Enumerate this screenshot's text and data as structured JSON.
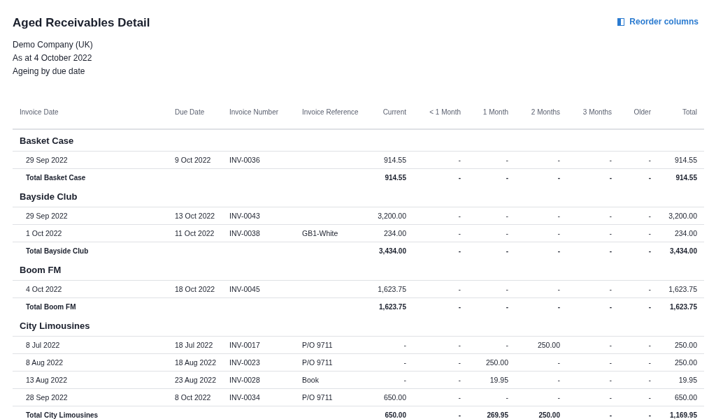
{
  "report": {
    "title": "Aged Receivables Detail",
    "company": "Demo Company (UK)",
    "as_at": "As at 4 October 2022",
    "ageing": "Ageing by due date"
  },
  "reorder_button": {
    "label": "Reorder columns"
  },
  "table": {
    "columns": [
      "Invoice Date",
      "Due Date",
      "Invoice Number",
      "Invoice Reference",
      "Current",
      "< 1 Month",
      "1 Month",
      "2 Months",
      "3 Months",
      "Older",
      "Total"
    ],
    "groups": [
      {
        "name": "Basket Case",
        "rows": [
          {
            "invoice_date": "29 Sep 2022",
            "due_date": "9 Oct 2022",
            "invoice_number": "INV-0036",
            "amounts": [
              "914.55",
              "-",
              "-",
              "-",
              "-",
              "-",
              "914.55"
            ]
          }
        ],
        "total": {
          "label": "Total Basket Case",
          "amounts": [
            "914.55",
            "-",
            "-",
            "-",
            "-",
            "-",
            "914.55"
          ]
        }
      },
      {
        "name": "Bayside Club",
        "rows": [
          {
            "invoice_date": "29 Sep 2022",
            "due_date": "13 Oct 2022",
            "invoice_number": "INV-0043",
            "amounts": [
              "3,200.00",
              "-",
              "-",
              "-",
              "-",
              "-",
              "3,200.00"
            ]
          },
          {
            "invoice_date": "1 Oct 2022",
            "due_date": "11 Oct 2022",
            "invoice_number": "INV-0038",
            "invoice_reference": "GB1-White",
            "amounts": [
              "234.00",
              "-",
              "-",
              "-",
              "-",
              "-",
              "234.00"
            ]
          }
        ],
        "total": {
          "label": "Total Bayside Club",
          "amounts": [
            "3,434.00",
            "-",
            "-",
            "-",
            "-",
            "-",
            "3,434.00"
          ]
        }
      },
      {
        "name": "Boom FM",
        "rows": [
          {
            "invoice_date": "4 Oct 2022",
            "due_date": "18 Oct 2022",
            "invoice_number": "INV-0045",
            "amounts": [
              "1,623.75",
              "-",
              "-",
              "-",
              "-",
              "-",
              "1,623.75"
            ]
          }
        ],
        "total": {
          "label": "Total Boom FM",
          "amounts": [
            "1,623.75",
            "-",
            "-",
            "-",
            "-",
            "-",
            "1,623.75"
          ]
        }
      },
      {
        "name": "City Limousines",
        "rows": [
          {
            "invoice_date": "8 Jul 2022",
            "due_date": "18 Jul 2022",
            "invoice_number": "INV-0017",
            "invoice_reference": "P/O 9711",
            "amounts": [
              "-",
              "-",
              "-",
              "250.00",
              "-",
              "-",
              "250.00"
            ]
          },
          {
            "invoice_date": "8 Aug 2022",
            "due_date": "18 Aug 2022",
            "invoice_number": "INV-0023",
            "invoice_reference": "P/O 9711",
            "amounts": [
              "-",
              "-",
              "250.00",
              "-",
              "-",
              "-",
              "250.00"
            ]
          },
          {
            "invoice_date": "13 Aug 2022",
            "due_date": "23 Aug 2022",
            "invoice_number": "INV-0028",
            "invoice_reference": "Book",
            "amounts": [
              "-",
              "-",
              "19.95",
              "-",
              "-",
              "-",
              "19.95"
            ]
          },
          {
            "invoice_date": "28 Sep 2022",
            "due_date": "8 Oct 2022",
            "invoice_number": "INV-0034",
            "invoice_reference": "P/O 9711",
            "amounts": [
              "650.00",
              "-",
              "-",
              "-",
              "-",
              "-",
              "650.00"
            ]
          }
        ],
        "total": {
          "label": "Total City Limousines",
          "amounts": [
            "650.00",
            "-",
            "269.95",
            "250.00",
            "-",
            "-",
            "1,169.95"
          ]
        }
      }
    ]
  }
}
